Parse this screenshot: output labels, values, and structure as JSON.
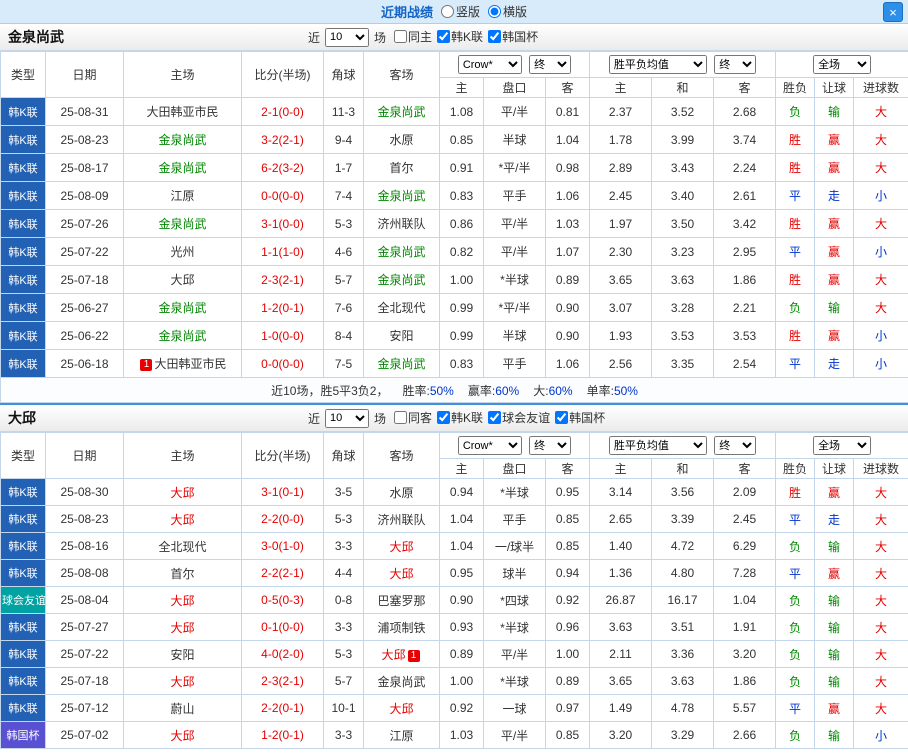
{
  "topbar": {
    "title": "近期战绩",
    "vertical_label": "竖版",
    "horizontal_label": "横版",
    "selected_layout": "横版",
    "close_icon": "×"
  },
  "columns": {
    "type": "类型",
    "date": "日期",
    "home": "主场",
    "score": "比分(半场)",
    "corner": "角球",
    "away": "客场",
    "odds_home": "主",
    "odds_line": "盘口",
    "odds_away": "客",
    "avg_home": "主",
    "avg_draw": "和",
    "avg_away": "客",
    "res_wdl": "胜负",
    "res_handicap": "让球",
    "res_goals": "进球数"
  },
  "league_colors": {
    "韩K联": "#2261b4",
    "球会友谊": "#00a2a2",
    "韩国杯": "#5a50d2"
  },
  "result_colors": {
    "胜": "#e60000",
    "赢": "#e60000",
    "大": "#e60000",
    "平": "#0033cc",
    "走": "#0033cc",
    "小": "#0033cc",
    "负": "#008800",
    "输": "#008800"
  },
  "score_color": "#e60000",
  "badge_bg": "#e60000",
  "badge_text_color": "#ffffff",
  "summary_value_color": "#0033cc",
  "sections": [
    {
      "team": "金泉尚武",
      "team_color": "#008800",
      "filter": {
        "near_label": "近",
        "count": "10",
        "games_label": "场",
        "checkboxes": [
          {
            "label": "同主",
            "checked": false
          },
          {
            "label": "韩K联",
            "checked": true
          },
          {
            "label": "韩国杯",
            "checked": true
          }
        ]
      },
      "dropdowns": {
        "odds_source": "Crow*",
        "odds_final": "终",
        "avg_source": "胜平负均值",
        "avg_final": "终",
        "scope": "全场"
      },
      "rows": [
        {
          "league": "韩K联",
          "date": "25-08-31",
          "home": "大田韩亚市民",
          "home_is_team": false,
          "score": "2-1(0-0)",
          "corner": "11-3",
          "away": "金泉尚武",
          "away_is_team": true,
          "odds": [
            "1.08",
            "平/半",
            "0.81"
          ],
          "avg": [
            "2.37",
            "3.52",
            "2.68"
          ],
          "results": [
            "负",
            "输",
            "大"
          ]
        },
        {
          "league": "韩K联",
          "date": "25-08-23",
          "home": "金泉尚武",
          "home_is_team": true,
          "score": "3-2(2-1)",
          "corner": "9-4",
          "away": "水原",
          "away_is_team": false,
          "odds": [
            "0.85",
            "半球",
            "1.04"
          ],
          "avg": [
            "1.78",
            "3.99",
            "3.74"
          ],
          "results": [
            "胜",
            "赢",
            "大"
          ]
        },
        {
          "league": "韩K联",
          "date": "25-08-17",
          "home": "金泉尚武",
          "home_is_team": true,
          "score": "6-2(3-2)",
          "corner": "1-7",
          "away": "首尔",
          "away_is_team": false,
          "odds": [
            "0.91",
            "*平/半",
            "0.98"
          ],
          "avg": [
            "2.89",
            "3.43",
            "2.24"
          ],
          "results": [
            "胜",
            "赢",
            "大"
          ]
        },
        {
          "league": "韩K联",
          "date": "25-08-09",
          "home": "江原",
          "home_is_team": false,
          "score": "0-0(0-0)",
          "corner": "7-4",
          "away": "金泉尚武",
          "away_is_team": true,
          "odds": [
            "0.83",
            "平手",
            "1.06"
          ],
          "avg": [
            "2.45",
            "3.40",
            "2.61"
          ],
          "results": [
            "平",
            "走",
            "小"
          ]
        },
        {
          "league": "韩K联",
          "date": "25-07-26",
          "home": "金泉尚武",
          "home_is_team": true,
          "score": "3-1(0-0)",
          "corner": "5-3",
          "away": "济州联队",
          "away_is_team": false,
          "odds": [
            "0.86",
            "平/半",
            "1.03"
          ],
          "avg": [
            "1.97",
            "3.50",
            "3.42"
          ],
          "results": [
            "胜",
            "赢",
            "大"
          ]
        },
        {
          "league": "韩K联",
          "date": "25-07-22",
          "home": "光州",
          "home_is_team": false,
          "score": "1-1(1-0)",
          "corner": "4-6",
          "away": "金泉尚武",
          "away_is_team": true,
          "odds": [
            "0.82",
            "平/半",
            "1.07"
          ],
          "avg": [
            "2.30",
            "3.23",
            "2.95"
          ],
          "results": [
            "平",
            "赢",
            "小"
          ]
        },
        {
          "league": "韩K联",
          "date": "25-07-18",
          "home": "大邱",
          "home_is_team": false,
          "score": "2-3(2-1)",
          "corner": "5-7",
          "away": "金泉尚武",
          "away_is_team": true,
          "odds": [
            "1.00",
            "*半球",
            "0.89"
          ],
          "avg": [
            "3.65",
            "3.63",
            "1.86"
          ],
          "results": [
            "胜",
            "赢",
            "大"
          ]
        },
        {
          "league": "韩K联",
          "date": "25-06-27",
          "home": "金泉尚武",
          "home_is_team": true,
          "score": "1-2(0-1)",
          "corner": "7-6",
          "away": "全北现代",
          "away_is_team": false,
          "odds": [
            "0.99",
            "*平/半",
            "0.90"
          ],
          "avg": [
            "3.07",
            "3.28",
            "2.21"
          ],
          "results": [
            "负",
            "输",
            "大"
          ]
        },
        {
          "league": "韩K联",
          "date": "25-06-22",
          "home": "金泉尚武",
          "home_is_team": true,
          "score": "1-0(0-0)",
          "corner": "8-4",
          "away": "安阳",
          "away_is_team": false,
          "odds": [
            "0.99",
            "半球",
            "0.90"
          ],
          "avg": [
            "1.93",
            "3.53",
            "3.53"
          ],
          "results": [
            "胜",
            "赢",
            "小"
          ]
        },
        {
          "league": "韩K联",
          "date": "25-06-18",
          "home": "大田韩亚市民",
          "home_is_team": false,
          "home_badge": "1",
          "score": "0-0(0-0)",
          "corner": "7-5",
          "away": "金泉尚武",
          "away_is_team": true,
          "odds": [
            "0.83",
            "平手",
            "1.06"
          ],
          "avg": [
            "2.56",
            "3.35",
            "2.54"
          ],
          "results": [
            "平",
            "走",
            "小"
          ]
        }
      ],
      "summary": {
        "prefix": "近10场，胜5平3负2，",
        "stats": [
          {
            "label": "胜率:",
            "value": "50%"
          },
          {
            "label": "赢率:",
            "value": "60%"
          },
          {
            "label": "大:",
            "value": "60%"
          },
          {
            "label": "单率:",
            "value": "50%"
          }
        ]
      }
    },
    {
      "team": "大邱",
      "team_color": "#e60000",
      "filter": {
        "near_label": "近",
        "count": "10",
        "games_label": "场",
        "checkboxes": [
          {
            "label": "同客",
            "checked": false
          },
          {
            "label": "韩K联",
            "checked": true
          },
          {
            "label": "球会友谊",
            "checked": true
          },
          {
            "label": "韩国杯",
            "checked": true
          }
        ]
      },
      "dropdowns": {
        "odds_source": "Crow*",
        "odds_final": "终",
        "avg_source": "胜平负均值",
        "avg_final": "终",
        "scope": "全场"
      },
      "rows": [
        {
          "league": "韩K联",
          "date": "25-08-30",
          "home": "大邱",
          "home_is_team": true,
          "score": "3-1(0-1)",
          "corner": "3-5",
          "away": "水原",
          "away_is_team": false,
          "odds": [
            "0.94",
            "*半球",
            "0.95"
          ],
          "avg": [
            "3.14",
            "3.56",
            "2.09"
          ],
          "results": [
            "胜",
            "赢",
            "大"
          ]
        },
        {
          "league": "韩K联",
          "date": "25-08-23",
          "home": "大邱",
          "home_is_team": true,
          "score": "2-2(0-0)",
          "corner": "5-3",
          "away": "济州联队",
          "away_is_team": false,
          "odds": [
            "1.04",
            "平手",
            "0.85"
          ],
          "avg": [
            "2.65",
            "3.39",
            "2.45"
          ],
          "results": [
            "平",
            "走",
            "大"
          ]
        },
        {
          "league": "韩K联",
          "date": "25-08-16",
          "home": "全北现代",
          "home_is_team": false,
          "score": "3-0(1-0)",
          "corner": "3-3",
          "away": "大邱",
          "away_is_team": true,
          "odds": [
            "1.04",
            "一/球半",
            "0.85"
          ],
          "avg": [
            "1.40",
            "4.72",
            "6.29"
          ],
          "results": [
            "负",
            "输",
            "大"
          ]
        },
        {
          "league": "韩K联",
          "date": "25-08-08",
          "home": "首尔",
          "home_is_team": false,
          "score": "2-2(2-1)",
          "corner": "4-4",
          "away": "大邱",
          "away_is_team": true,
          "odds": [
            "0.95",
            "球半",
            "0.94"
          ],
          "avg": [
            "1.36",
            "4.80",
            "7.28"
          ],
          "results": [
            "平",
            "赢",
            "大"
          ]
        },
        {
          "league": "球会友谊",
          "date": "25-08-04",
          "home": "大邱",
          "home_is_team": true,
          "score": "0-5(0-3)",
          "corner": "0-8",
          "away": "巴塞罗那",
          "away_is_team": false,
          "odds": [
            "0.90",
            "*四球",
            "0.92"
          ],
          "avg": [
            "26.87",
            "16.17",
            "1.04"
          ],
          "results": [
            "负",
            "输",
            "大"
          ]
        },
        {
          "league": "韩K联",
          "date": "25-07-27",
          "home": "大邱",
          "home_is_team": true,
          "score": "0-1(0-0)",
          "corner": "3-3",
          "away": "浦项制铁",
          "away_is_team": false,
          "odds": [
            "0.93",
            "*半球",
            "0.96"
          ],
          "avg": [
            "3.63",
            "3.51",
            "1.91"
          ],
          "results": [
            "负",
            "输",
            "大"
          ]
        },
        {
          "league": "韩K联",
          "date": "25-07-22",
          "home": "安阳",
          "home_is_team": false,
          "score": "4-0(2-0)",
          "corner": "5-3",
          "away": "大邱",
          "away_is_team": true,
          "away_badge": "1",
          "odds": [
            "0.89",
            "平/半",
            "1.00"
          ],
          "avg": [
            "2.11",
            "3.36",
            "3.20"
          ],
          "results": [
            "负",
            "输",
            "大"
          ]
        },
        {
          "league": "韩K联",
          "date": "25-07-18",
          "home": "大邱",
          "home_is_team": true,
          "score": "2-3(2-1)",
          "corner": "5-7",
          "away": "金泉尚武",
          "away_is_team": false,
          "odds": [
            "1.00",
            "*半球",
            "0.89"
          ],
          "avg": [
            "3.65",
            "3.63",
            "1.86"
          ],
          "results": [
            "负",
            "输",
            "大"
          ]
        },
        {
          "league": "韩K联",
          "date": "25-07-12",
          "home": "蔚山",
          "home_is_team": false,
          "score": "2-2(0-1)",
          "corner": "10-1",
          "away": "大邱",
          "away_is_team": true,
          "odds": [
            "0.92",
            "一球",
            "0.97"
          ],
          "avg": [
            "1.49",
            "4.78",
            "5.57"
          ],
          "results": [
            "平",
            "赢",
            "大"
          ]
        },
        {
          "league": "韩国杯",
          "date": "25-07-02",
          "home": "大邱",
          "home_is_team": true,
          "score": "1-2(0-1)",
          "corner": "3-3",
          "away": "江原",
          "away_is_team": false,
          "odds": [
            "1.03",
            "平/半",
            "0.85"
          ],
          "avg": [
            "3.20",
            "3.29",
            "2.66"
          ],
          "results": [
            "负",
            "输",
            "小"
          ]
        }
      ]
    }
  ]
}
